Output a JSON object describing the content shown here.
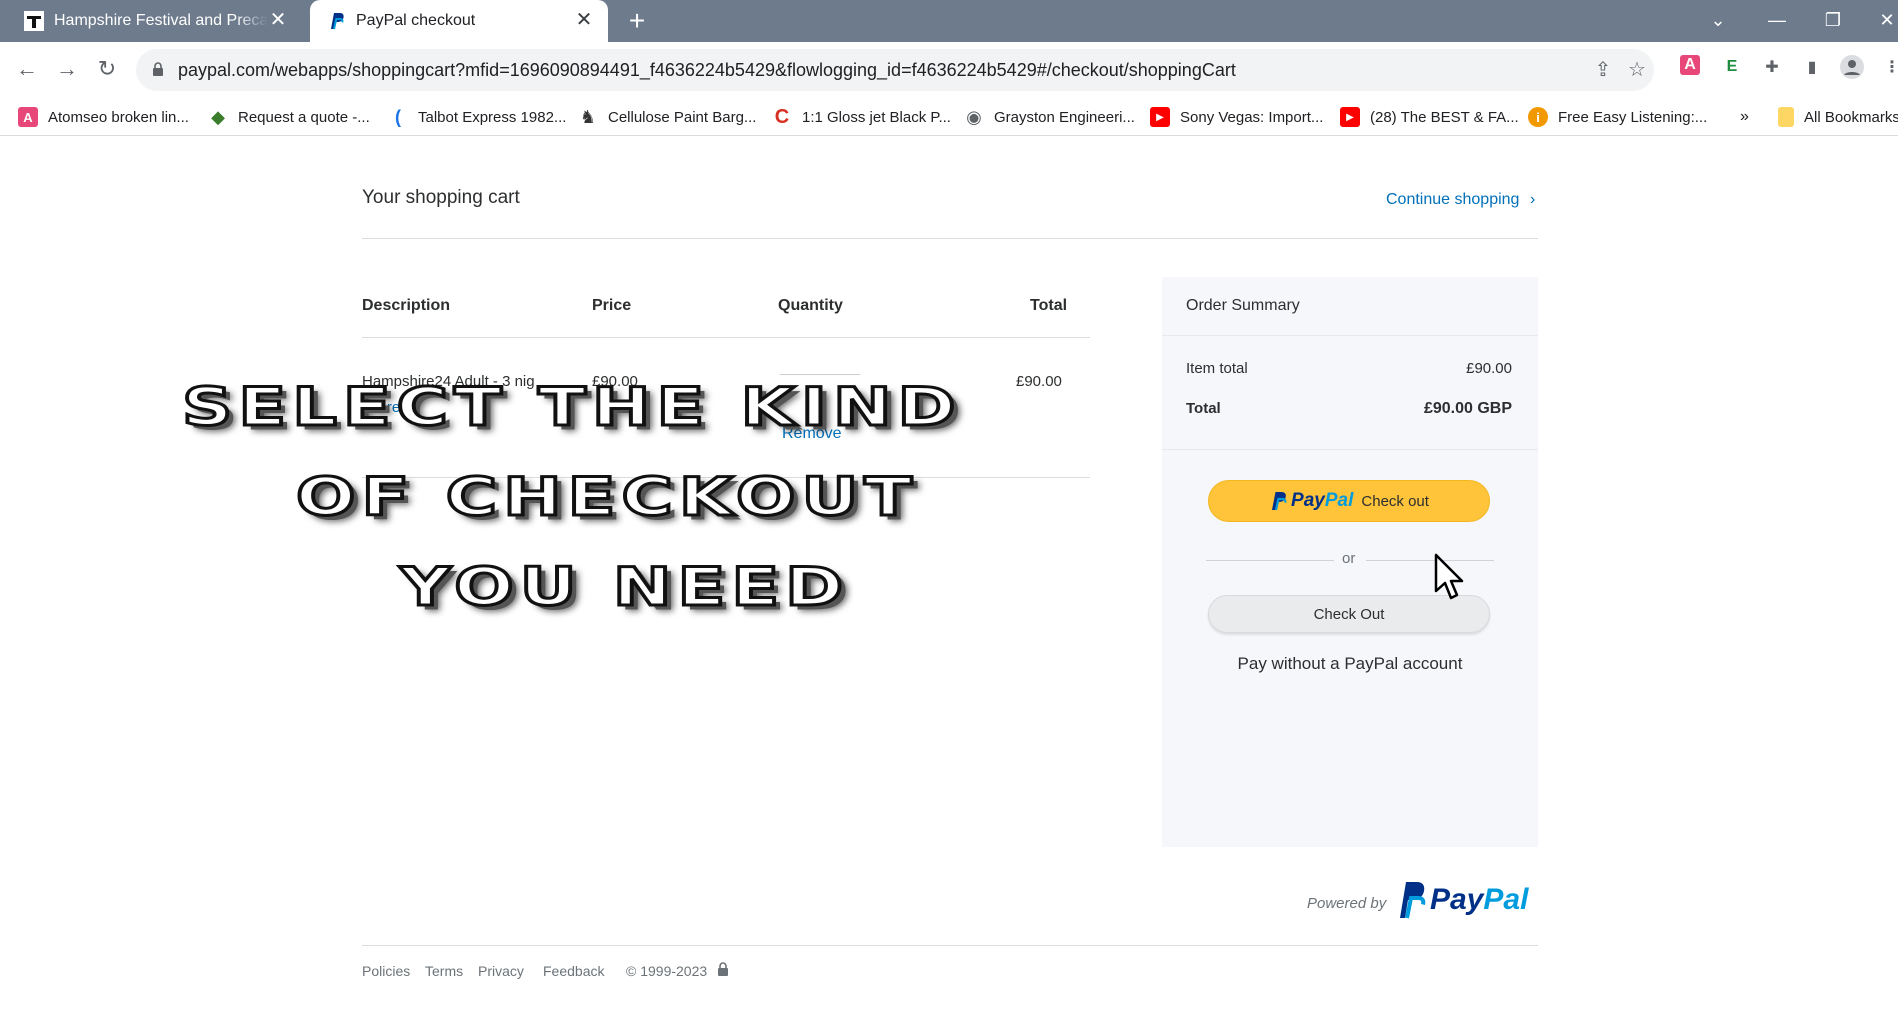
{
  "browser": {
    "tabs": [
      {
        "title": "Hampshire Festival and Precamp",
        "close": "✕"
      },
      {
        "title": "PayPal checkout",
        "close": "✕"
      }
    ],
    "new_tab": "+",
    "url": "paypal.com/webapps/shoppingcart?mfid=1696090894491_f4636224b5429&flowlogging_id=f4636224b5429#/checkout/shoppingCart",
    "bookmarks": [
      {
        "label": "Atomseo broken lin...",
        "icon": "A",
        "color": "#e8477a"
      },
      {
        "label": "Request a quote -...",
        "icon": "◆",
        "color": "#3a7d2c"
      },
      {
        "label": "Talbot Express 1982...",
        "icon": "(",
        "color": "#1a73e8"
      },
      {
        "label": "Cellulose Paint Barg...",
        "icon": "♞",
        "color": "#333333"
      },
      {
        "label": "1:1 Gloss jet Black P...",
        "icon": "C",
        "color": "#d93025"
      },
      {
        "label": "Grayston Engineeri...",
        "icon": "◉",
        "color": "#5f6368"
      },
      {
        "label": "Sony Vegas: Import...",
        "icon": "▶",
        "color": "#ff0000"
      },
      {
        "label": "(28) The BEST & FA...",
        "icon": "▶",
        "color": "#ff0000"
      },
      {
        "label": "Free Easy Listening:...",
        "icon": "i",
        "color": "#f29900"
      }
    ],
    "bookmarks_more": "»",
    "all_bookmarks": "All Bookmarks"
  },
  "cart": {
    "title": "Your shopping cart",
    "continue": "Continue shopping",
    "continue_chevron": "›",
    "headers": {
      "description": "Description",
      "price": "Price",
      "quantity": "Quantity",
      "total": "Total"
    },
    "item": {
      "description": "Hampshire24 Adult - 3 nig",
      "more": "more",
      "price": "£90.00",
      "total": "£90.00",
      "remove": "Remove"
    }
  },
  "summary": {
    "title": "Order Summary",
    "item_total_label": "Item total",
    "item_total_value": "£90.00",
    "total_label": "Total",
    "total_value": "£90.00 GBP",
    "paypal_button_logo_pay": "Pay",
    "paypal_button_logo_pal": "Pal",
    "paypal_button_label": "Check out",
    "or": "or",
    "checkout_button": "Check Out",
    "no_account": "Pay without a PayPal account"
  },
  "footer": {
    "powered_by": "Powered by",
    "logo_pay": "Pay",
    "logo_pal": "Pal",
    "links": [
      "Policies",
      "Terms",
      "Privacy",
      "Feedback"
    ],
    "copyright": "© 1999-2023"
  },
  "overlay": {
    "line1": "SELECT THE KIND",
    "line2": "OF CHECKOUT",
    "line3": "YOU NEED"
  }
}
